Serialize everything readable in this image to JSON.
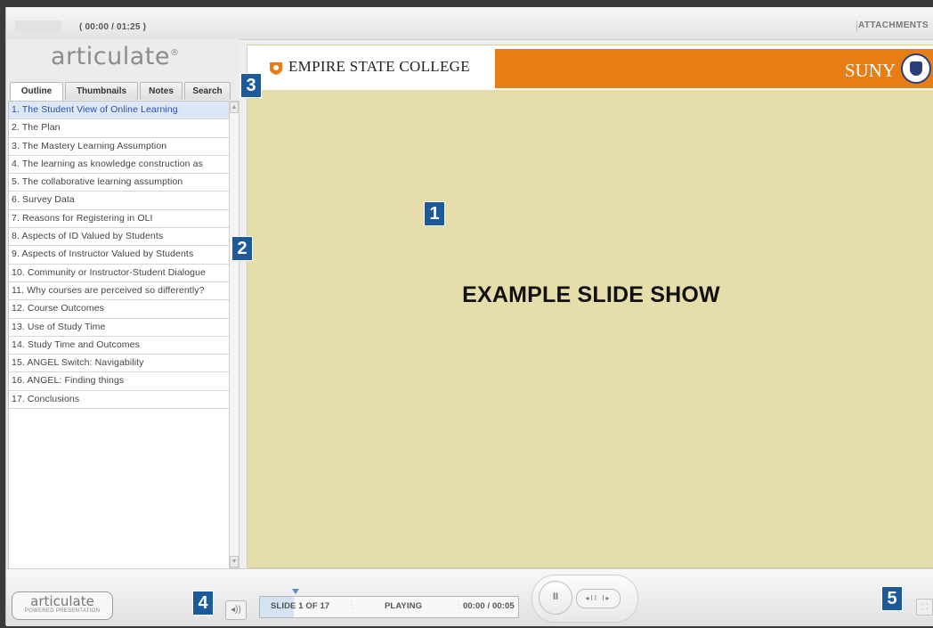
{
  "topbar": {
    "time": "( 00:00 / 01:25 )",
    "attachments_label": "ATTACHMENTS"
  },
  "sidebar": {
    "logo": "articulate",
    "logo_mark": "®",
    "tabs": [
      {
        "label": "Outline",
        "active": true
      },
      {
        "label": "Thumbnails",
        "active": false
      },
      {
        "label": "Notes",
        "active": false
      },
      {
        "label": "Search",
        "active": false
      }
    ],
    "outline": [
      "1. The Student View of Online Learning",
      "2. The Plan",
      "3. The Mastery Learning Assumption",
      "4. The learning as knowledge construction as",
      "5. The collaborative learning assumption",
      "6. Survey Data",
      "7. Reasons for Registering in OLI",
      "8. Aspects of ID Valued by Students",
      "9. Aspects of Instructor Valued by Students",
      "10. Community or Instructor-Student Dialogue",
      "11. Why courses are perceived so differently?",
      "12. Course Outcomes",
      "13. Use of Study Time",
      "14. Study Time and Outcomes",
      "15. ANGEL Switch: Navigability",
      "16. ANGEL: Finding things",
      "17. Conclusions"
    ],
    "active_index": 0
  },
  "slide": {
    "college": "EMPIRE STATE COLLEGE",
    "suny": "SUNY",
    "title": "EXAMPLE SLIDE SHOW"
  },
  "badges": [
    "1",
    "2",
    "3",
    "4",
    "5"
  ],
  "player": {
    "logo_word": "articulate",
    "logo_sub": "POWERED PRESENTATION",
    "slide_counter": "SLIDE 1 OF 17",
    "status": "PLAYING",
    "slide_time": "00:00 / 00:05",
    "pause_label": "II",
    "prev_next_label": "◂II I▸",
    "volume_icon": "speaker-icon",
    "fullscreen_icon": "fullscreen-icon"
  },
  "colors": {
    "accent": "#e67e14",
    "slide_bg": "#e5ddaa",
    "badge": "#1d5a9a",
    "active_item": "#dde8f6"
  }
}
